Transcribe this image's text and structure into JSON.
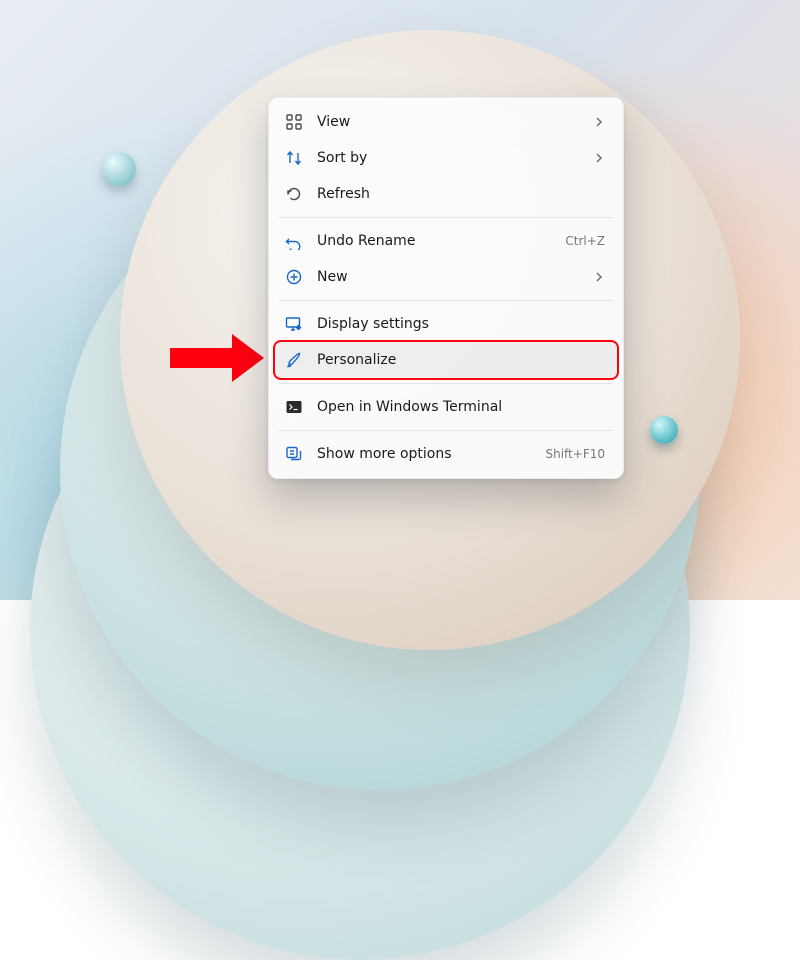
{
  "context_menu": {
    "groups": [
      [
        {
          "id": "view",
          "label": "View",
          "submenu": true,
          "icon": "grid"
        },
        {
          "id": "sort",
          "label": "Sort by",
          "submenu": true,
          "icon": "sort"
        },
        {
          "id": "refresh",
          "label": "Refresh",
          "icon": "refresh"
        }
      ],
      [
        {
          "id": "undo",
          "label": "Undo Rename",
          "shortcut": "Ctrl+Z",
          "icon": "undo"
        },
        {
          "id": "new",
          "label": "New",
          "submenu": true,
          "icon": "plus"
        }
      ],
      [
        {
          "id": "display",
          "label": "Display settings",
          "icon": "display"
        },
        {
          "id": "personalize",
          "label": "Personalize",
          "icon": "brush",
          "highlighted": true
        }
      ],
      [
        {
          "id": "terminal",
          "label": "Open in Windows Terminal",
          "icon": "terminal"
        }
      ],
      [
        {
          "id": "more",
          "label": "Show more options",
          "shortcut": "Shift+F10",
          "icon": "more"
        }
      ]
    ]
  },
  "annotation": {
    "kind": "arrow",
    "color": "#ff0010",
    "points_to": "personalize"
  }
}
